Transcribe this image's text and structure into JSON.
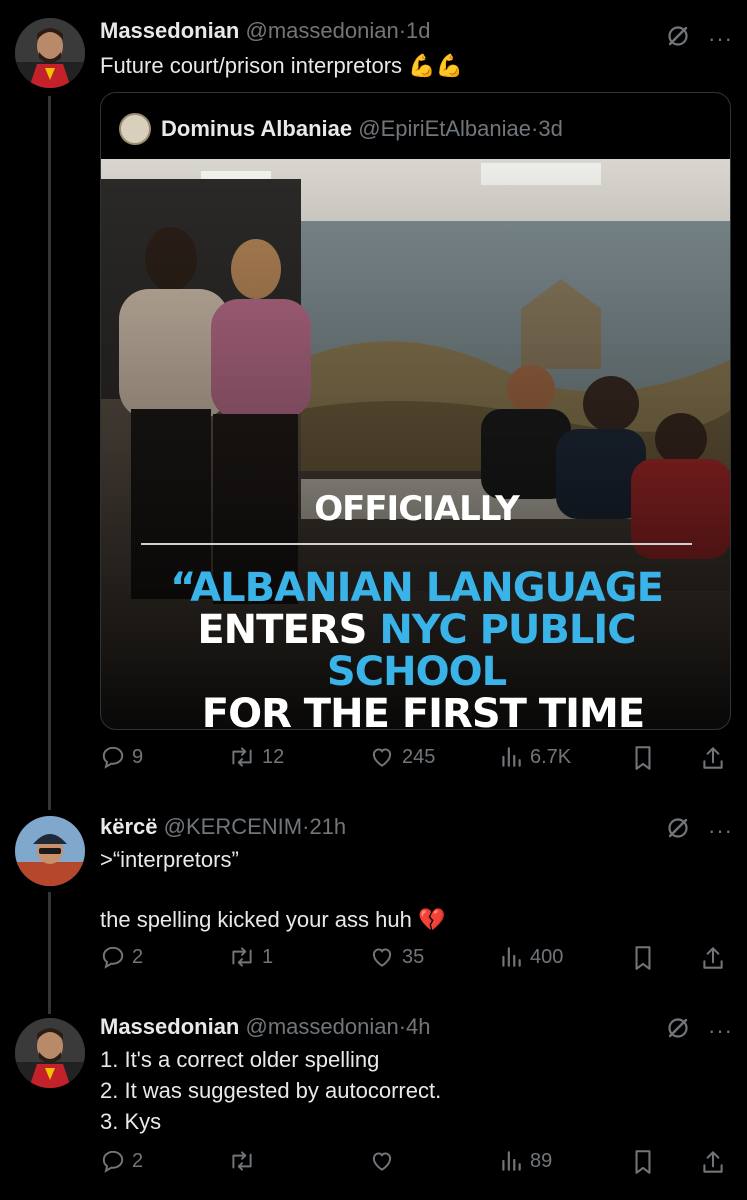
{
  "thread": {
    "post1": {
      "name": "Massedonian",
      "handle": "@massedonian",
      "sep": "·",
      "time": "1d",
      "text": "Future court/prison interpretors 💪💪",
      "quote": {
        "name": "Dominus Albaniae",
        "handle": "@EpiriEtAlbaniae",
        "sep": "·",
        "time": "3d",
        "overlay": {
          "line1": "OFFICIALLY",
          "line2_quote": "“ALBANIAN LANGUAGE",
          "line3_a": "ENTERS ",
          "line3_b": "NYC PUBLIC",
          "line4_a": "SCHOOL",
          "line4_b": " FOR THE FIRST TIME"
        }
      },
      "stats": {
        "replies": "9",
        "reposts": "12",
        "likes": "245",
        "views": "6.7K"
      }
    },
    "post2": {
      "name": "kërcë",
      "handle": "@KERCENIM",
      "sep": "·",
      "time": "21h",
      "line1": ">“interpretors”",
      "line2": "the spelling kicked your ass huh 💔",
      "stats": {
        "replies": "2",
        "reposts": "1",
        "likes": "35",
        "views": "400"
      }
    },
    "post3": {
      "name": "Massedonian",
      "handle": "@massedonian",
      "sep": "·",
      "time": "4h",
      "line1": "1. It's a correct older spelling",
      "line2": "2. It was suggested by autocorrect.",
      "line3": "3. Kys",
      "stats": {
        "replies": "2",
        "reposts": "",
        "likes": "",
        "views": "89"
      }
    }
  },
  "colors": {
    "background": "#000000",
    "text": "#e7e9ea",
    "muted": "#71767b",
    "accent_blue": "#3ab3e8",
    "border": "#2f3336"
  },
  "icons": [
    "grok-slash-icon",
    "more-icon",
    "reply-icon",
    "repost-icon",
    "like-icon",
    "views-icon",
    "bookmark-icon",
    "share-icon"
  ]
}
